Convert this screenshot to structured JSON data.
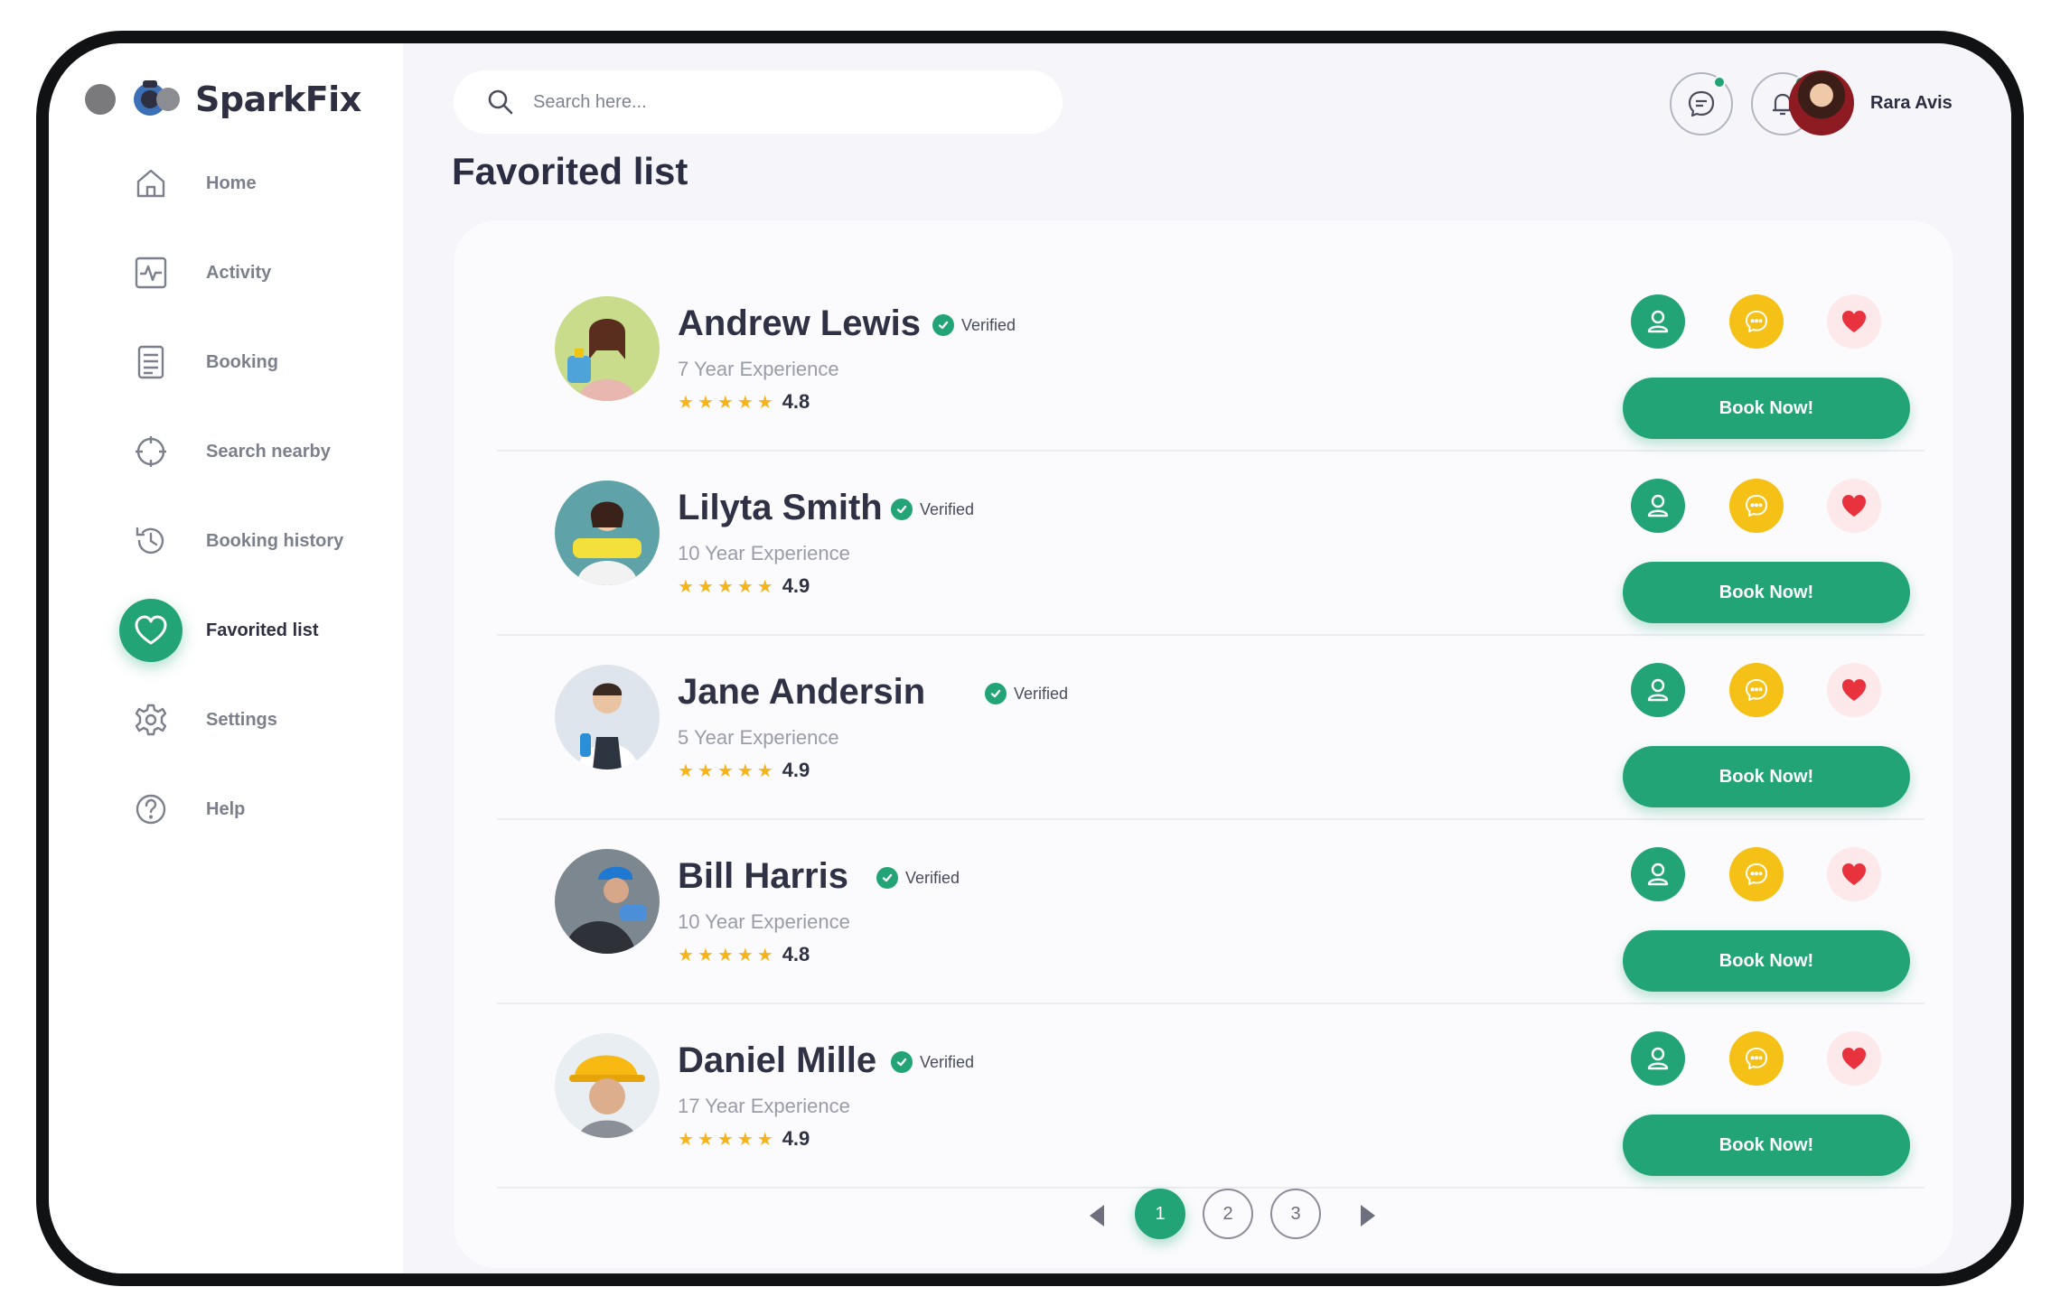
{
  "app": {
    "brand": "SparkFix"
  },
  "nav": [
    {
      "label": "Home",
      "icon": "home-icon",
      "active": false
    },
    {
      "label": "Activity",
      "icon": "activity-icon",
      "active": false
    },
    {
      "label": "Booking",
      "icon": "document-icon",
      "active": false
    },
    {
      "label": "Search nearby",
      "icon": "crosshair-icon",
      "active": false
    },
    {
      "label": "Booking history",
      "icon": "history-icon",
      "active": false
    },
    {
      "label": "Favorited list",
      "icon": "heart-icon",
      "active": true
    },
    {
      "label": "Settings",
      "icon": "gear-icon",
      "active": false
    },
    {
      "label": "Help",
      "icon": "help-icon",
      "active": false
    }
  ],
  "search": {
    "placeholder": "Search here..."
  },
  "header": {
    "user_name": "Rara Avis",
    "messages_icon": "chat-icon",
    "notifications_icon": "bell-icon"
  },
  "page": {
    "title": "Favorited list"
  },
  "favorites": [
    {
      "name": "Andrew Lewis",
      "verified": "Verified",
      "experience": "7 Year Experience",
      "rating": "4.8",
      "stars": 5,
      "book_label": "Book Now!"
    },
    {
      "name": "Lilyta Smith",
      "verified": "Verified",
      "experience": "10 Year Experience",
      "rating": "4.9",
      "stars": 5,
      "book_label": "Book Now!"
    },
    {
      "name": "Jane Andersin",
      "verified": "Verified",
      "experience": "5 Year Experience",
      "rating": "4.9",
      "stars": 5,
      "book_label": "Book Now!"
    },
    {
      "name": "Bill Harris",
      "verified": "Verified",
      "experience": "10 Year Experience",
      "rating": "4.8",
      "stars": 5,
      "book_label": "Book Now!"
    },
    {
      "name": "Daniel Mille",
      "verified": "Verified",
      "experience": "17 Year Experience",
      "rating": "4.9",
      "stars": 5,
      "book_label": "Book Now!"
    }
  ],
  "pagination": {
    "pages": [
      "1",
      "2",
      "3"
    ],
    "current": "1"
  },
  "colors": {
    "accent": "#22a477",
    "chat": "#f6c117",
    "favorite": "#e8333f",
    "star": "#f6b419"
  }
}
